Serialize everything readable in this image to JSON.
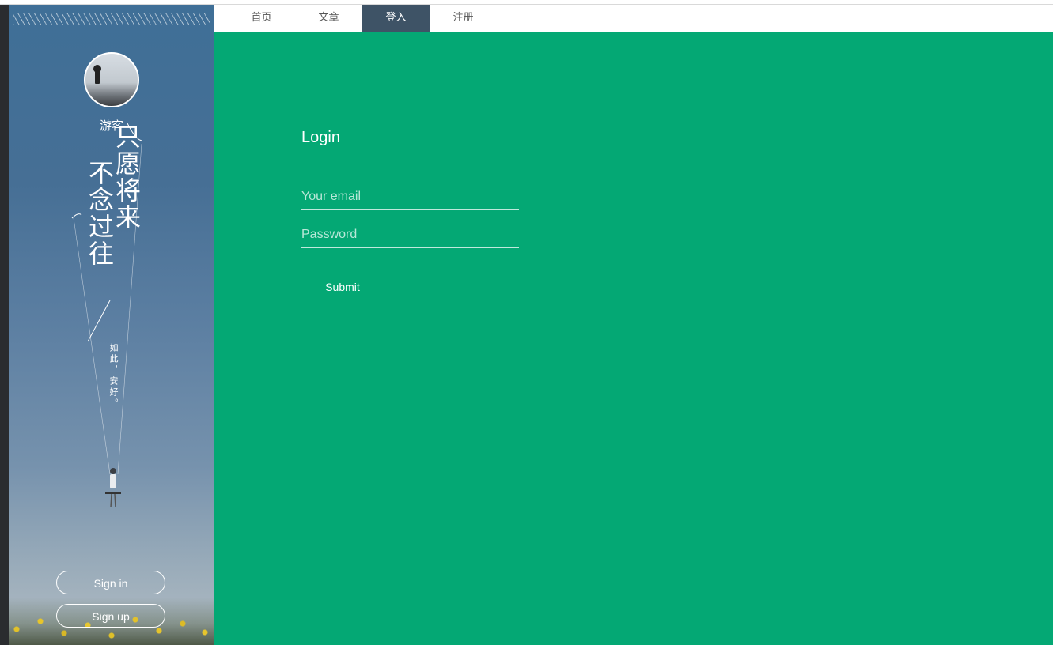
{
  "nav": {
    "items": [
      {
        "label": "首页",
        "active": false
      },
      {
        "label": "文章",
        "active": false
      },
      {
        "label": "登入",
        "active": true
      },
      {
        "label": "注册",
        "active": false
      }
    ]
  },
  "sidebar": {
    "username": "游客",
    "poem_col1": "不念过往",
    "poem_col2": "只愿将来",
    "sub_poem": "如此，安好。",
    "signin_label": "Sign in",
    "signup_label": "Sign up"
  },
  "login": {
    "title": "Login",
    "email_placeholder": "Your email",
    "password_placeholder": "Password",
    "submit_label": "Submit"
  },
  "colors": {
    "main_bg": "#04a874",
    "nav_active": "#3e5366",
    "sidebar_sky": "#466f95"
  },
  "icons": [
    "avatar-photo",
    "swing-girl-illustration"
  ]
}
